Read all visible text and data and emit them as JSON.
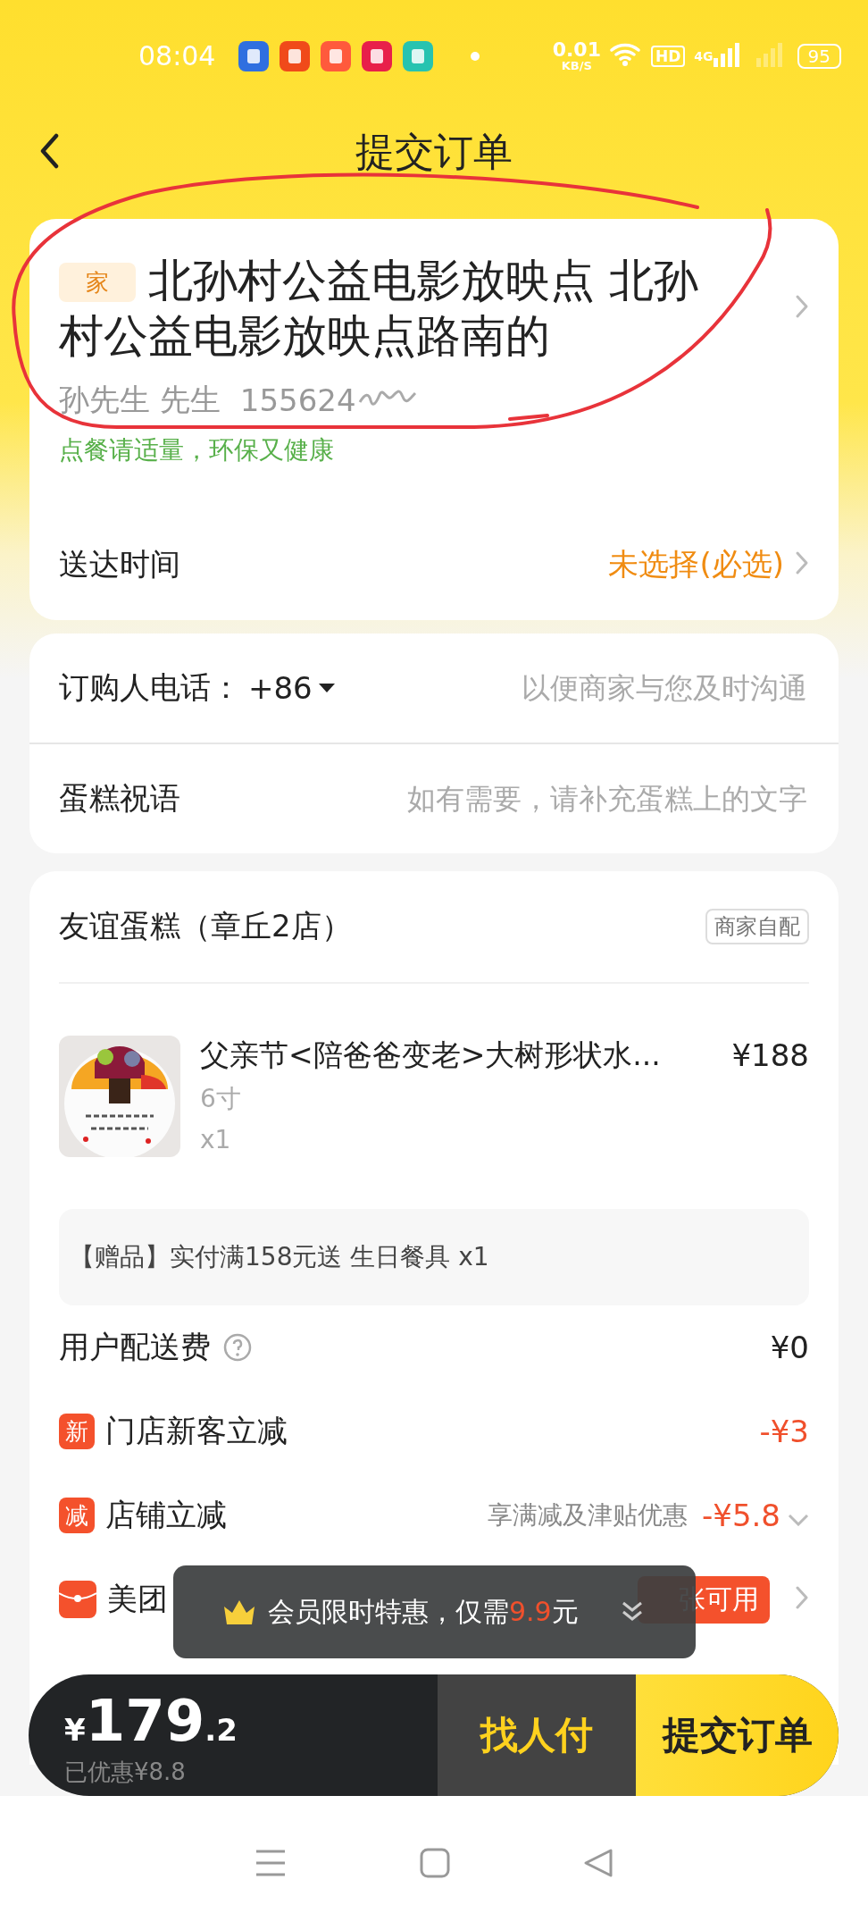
{
  "status_bar": {
    "time": "08:04",
    "net_speed": "0.01",
    "net_unit": "KB/S",
    "hd": "HD",
    "net_type": "4G",
    "battery": "95"
  },
  "header": {
    "title": "提交订单"
  },
  "address": {
    "tag": "家",
    "text": "北孙村公益电影放映点 北孙村公益电影放映点路南的",
    "contact": "孙先生 先生",
    "phone": "155624",
    "hint": "点餐请适量，环保又健康",
    "time_label": "送达时间",
    "time_value": "未选择(必选)"
  },
  "contact_form": [
    {
      "label": "订购人电话：",
      "prefix": "+86",
      "placeholder": "以便商家与您及时沟通"
    },
    {
      "label": "蛋糕祝语",
      "placeholder": "如有需要，请补充蛋糕上的文字"
    }
  ],
  "shop": {
    "name": "友谊蛋糕（章丘2店）",
    "delivery_tag": "商家自配",
    "items": [
      {
        "kind": "picture",
        "title": "父亲节<陪爸爸变老>大树形状水...",
        "spec": "6寸",
        "qty": "x1",
        "price": "¥188"
      }
    ],
    "gift": "【赠品】实付满158元送 生日餐具 x1",
    "fees": [
      {
        "kind": "fee",
        "label": "用户配送费",
        "amount": "¥0"
      },
      {
        "kind": "discount",
        "badge": "新",
        "label": "门店新客立减",
        "amount": "-¥3"
      },
      {
        "kind": "discount",
        "badge": "减",
        "label": "店铺立减",
        "note": "享满减及津贴优惠",
        "amount": "-¥5.8",
        "dropdown": true
      },
      {
        "kind": "coupon",
        "label": "美团",
        "badge": "张可用"
      }
    ]
  },
  "toast": {
    "text_before": "会员限时特惠，仅需",
    "price": "9.9",
    "text_after": "元"
  },
  "pay_bar": {
    "currency": "¥",
    "amount_int": "179",
    "amount_dec": ".2",
    "saved": "已优惠¥8.8",
    "buttons": [
      {
        "kind": "secondary",
        "label": "找人付"
      },
      {
        "kind": "primary",
        "label": "提交订单"
      }
    ]
  }
}
